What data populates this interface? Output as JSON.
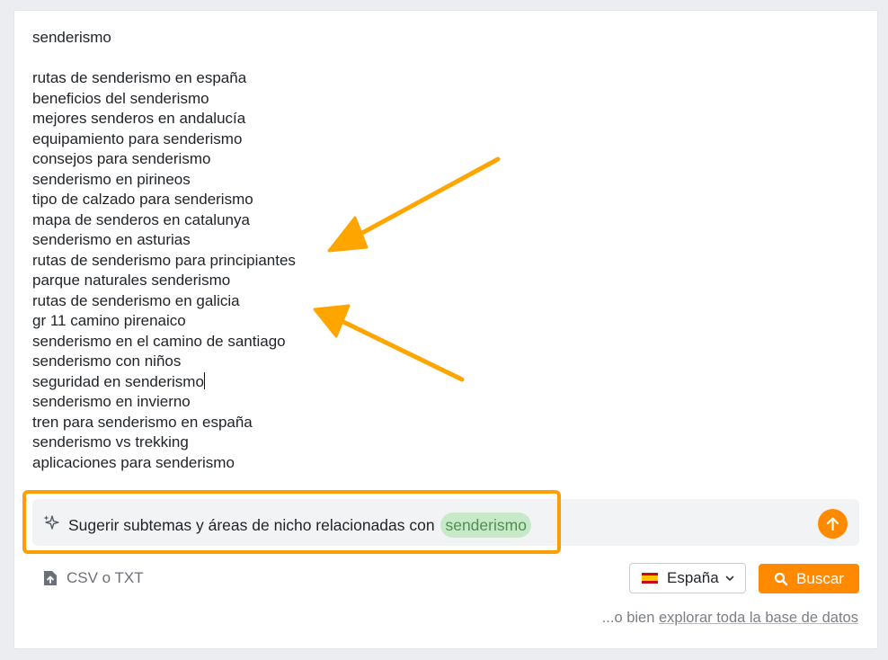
{
  "keywords": {
    "seed": "senderismo",
    "items": [
      "rutas de senderismo en españa",
      "beneficios del senderismo",
      "mejores senderos en andalucía",
      "equipamiento para senderismo",
      "consejos para senderismo",
      "senderismo en pirineos",
      "tipo de calzado para senderismo",
      "mapa de senderos en catalunya",
      "senderismo en asturias",
      "rutas de senderismo para principiantes",
      "parque naturales senderismo",
      "rutas de senderismo en galicia",
      "gr 11 camino pirenaico",
      "senderismo en el camino de santiago",
      "senderismo con niños",
      "seguridad en senderismo",
      "senderismo en invierno",
      "tren para senderismo en españa",
      "senderismo vs trekking",
      "aplicaciones para senderismo"
    ]
  },
  "suggest": {
    "text": "Sugerir subtemas y áreas de nicho relacionadas con",
    "chip": "senderismo",
    "icon": "sparkle-icon"
  },
  "upload": {
    "label": "CSV o TXT",
    "icon": "file-upload-icon"
  },
  "country": {
    "selected": "España",
    "icon": "spain-flag-icon"
  },
  "search_button": {
    "label": "Buscar",
    "icon": "search-icon"
  },
  "footer": {
    "prefix": "...o bien",
    "link": "explorar toda la base de datos"
  },
  "colors": {
    "accent": "#ff8a00",
    "annotation": "#ffa500",
    "chip_bg": "#c8e9c8",
    "chip_text": "#4e8f53"
  }
}
